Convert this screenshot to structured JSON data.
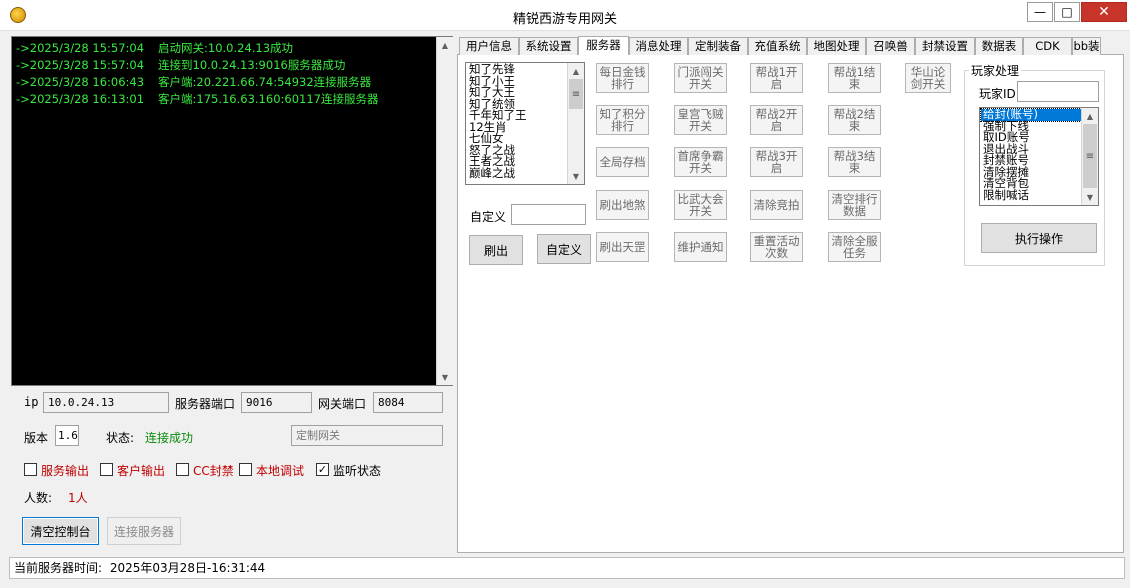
{
  "window": {
    "title": "精锐西游专用网关",
    "minimize": "—",
    "maximize": "□",
    "close": "✕"
  },
  "console": {
    "lines": [
      {
        "time": "->2025/3/28 15:57:04",
        "msg": "启动网关:10.0.24.13成功"
      },
      {
        "time": "->2025/3/28 15:57:04",
        "msg": "连接到10.0.24.13:9016服务器成功"
      },
      {
        "time": "->2025/3/28 16:06:43",
        "msg": "客户端:20.221.66.74:54932连接服务器"
      },
      {
        "time": "->2025/3/28 16:13:01",
        "msg": "客户端:175.16.63.160:60117连接服务器"
      }
    ]
  },
  "config": {
    "ip_label": "ip",
    "ip_value": "10.0.24.13",
    "server_port_label": "服务器端口",
    "server_port_value": "9016",
    "gateway_port_label": "网关端口",
    "gateway_port_value": "8084",
    "version_label": "版本",
    "version_value": "1.6",
    "status_label": "状态:",
    "status_value": "连接成功",
    "custom_gateway_placeholder": "定制网关"
  },
  "checkboxes": [
    {
      "label": "服务输出",
      "checked": false
    },
    {
      "label": "客户输出",
      "checked": false
    },
    {
      "label": "CC封禁",
      "checked": false
    },
    {
      "label": "本地调试",
      "checked": false
    },
    {
      "label": "监听状态",
      "checked": true
    }
  ],
  "check_mark": "✓",
  "people": {
    "label": "人数:",
    "value": "1人"
  },
  "buttons": {
    "clear_console": "清空控制台",
    "connect_server": "连接服务器"
  },
  "statusbar": {
    "label": "当前服务器时间:",
    "value": "2025年03月28日-16:31:44"
  },
  "tabs": [
    "用户信息",
    "系统设置",
    "服务器",
    "消息处理",
    "定制装备",
    "充值系统",
    "地图处理",
    "召唤兽",
    "封禁设置",
    "数据表",
    "CDK",
    "bb装"
  ],
  "server_tab": {
    "list_items": [
      "知了先锋",
      "知了小王",
      "知了大王",
      "知了统领",
      "千年知了王",
      "12生肖",
      "七仙女",
      "怒了之战",
      "王者之战",
      "巅峰之战"
    ],
    "custom_label": "自定义",
    "refresh_button": "刷出",
    "custom_button": "自定义",
    "grid": [
      [
        "每日金钱排行",
        "门派闯关开关",
        "帮战1开启",
        "帮战1结束",
        "华山论剑开关"
      ],
      [
        "知了积分排行",
        "皇宫飞贼开关",
        "帮战2开启",
        "帮战2结束"
      ],
      [
        "全局存档",
        "首席争霸开关",
        "帮战3开启",
        "帮战3结束"
      ],
      [
        "刷出地煞",
        "比武大会开关",
        "清除竞拍",
        "清空排行数据"
      ],
      [
        "刷出天罡",
        "维护通知",
        "重置活动次数",
        "清除全服任务"
      ]
    ],
    "player_group": {
      "title": "玩家处理",
      "id_label": "玩家ID",
      "actions": [
        "给封(账号)",
        "强制下线",
        "取ID账号",
        "退出战斗",
        "封禁账号",
        "清除摆摊",
        "清空背包",
        "限制喊话"
      ],
      "execute_button": "执行操作"
    }
  },
  "icons": {
    "scroll_up": "▲",
    "scroll_down": "▼",
    "scroll_grip": "≡"
  }
}
